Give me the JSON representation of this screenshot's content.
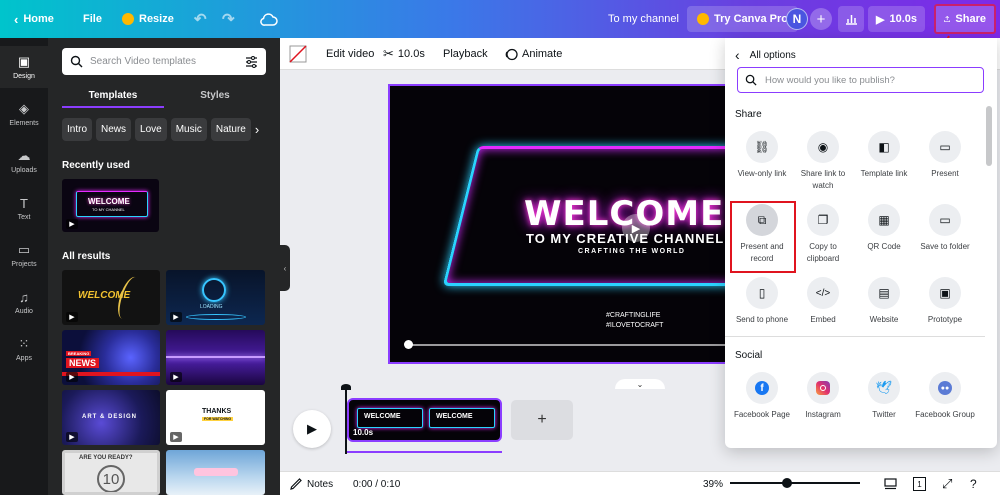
{
  "topbar": {
    "home": "Home",
    "file": "File",
    "resize": "Resize",
    "channel": "To my channel",
    "try_pro": "Try Canva Pro",
    "avatar_initial": "N",
    "play_duration": "10.0s",
    "share": "Share"
  },
  "rail": [
    {
      "label": "Design",
      "icon": "layout-icon"
    },
    {
      "label": "Elements",
      "icon": "shapes-icon"
    },
    {
      "label": "Uploads",
      "icon": "cloud-upload-icon"
    },
    {
      "label": "Text",
      "icon": "text-icon"
    },
    {
      "label": "Projects",
      "icon": "folder-icon"
    },
    {
      "label": "Audio",
      "icon": "music-icon"
    },
    {
      "label": "Apps",
      "icon": "apps-icon"
    }
  ],
  "panel": {
    "search_placeholder": "Search Video templates",
    "tabs": [
      "Templates",
      "Styles"
    ],
    "chips": [
      "Intro",
      "News",
      "Love",
      "Music",
      "Nature"
    ],
    "recently_used": "Recently used",
    "all_results": "All results",
    "thumb_texts": {
      "recent_title": "WELCOME",
      "recent_sub": "TO MY CHANNEL",
      "r1_title": "WELCOME",
      "r2_title": "LOADING",
      "r3_badge": "BREAKING",
      "r3_title": "NEWS",
      "r5_title": "ART & DESIGN",
      "r6_title": "THANKS",
      "r6_sub": "FOR WATCHING",
      "r7_title": "ARE YOU READY?",
      "r7_num": "10"
    }
  },
  "edit_toolbar": {
    "edit_video": "Edit video",
    "duration": "10.0s",
    "playback": "Playback",
    "animate": "Animate"
  },
  "canvas": {
    "welcome": "WELCOME",
    "to_my": "TO MY CREATIVE CHANNEL",
    "crafting": "CRAFTING THE WORLD",
    "tag1": "#CRAFTINGLIFE",
    "tag2": "#ILOVETOCRAFT"
  },
  "timeline": {
    "clip_text": "WELCOME",
    "clip_duration": "10.0s",
    "add": "+"
  },
  "bottombar": {
    "notes": "Notes",
    "time": "0:00 / 0:10",
    "zoom": "39%",
    "page_count": "1"
  },
  "share_panel": {
    "back_title": "All options",
    "search_placeholder": "How would you like to publish?",
    "share_heading": "Share",
    "share_items": [
      {
        "label": "View-only link",
        "icon": "link-icon"
      },
      {
        "label": "Share link to watch",
        "icon": "eye-icon"
      },
      {
        "label": "Template link",
        "icon": "template-icon"
      },
      {
        "label": "Present",
        "icon": "present-icon"
      },
      {
        "label": "Present and record",
        "icon": "record-icon"
      },
      {
        "label": "Copy to clipboard",
        "icon": "copy-icon"
      },
      {
        "label": "QR Code",
        "icon": "qr-code-icon"
      },
      {
        "label": "Save to folder",
        "icon": "folder-icon"
      },
      {
        "label": "Send to phone",
        "icon": "phone-icon"
      },
      {
        "label": "Embed",
        "icon": "embed-icon"
      },
      {
        "label": "Website",
        "icon": "website-icon"
      },
      {
        "label": "Prototype",
        "icon": "prototype-icon"
      }
    ],
    "social_heading": "Social",
    "social_items": [
      {
        "label": "Facebook Page",
        "color": "#1877f2"
      },
      {
        "label": "Instagram",
        "color": "#e1306c"
      },
      {
        "label": "Twitter",
        "color": "#1d9bf0"
      },
      {
        "label": "Facebook Group",
        "color": "#5b7bd5"
      }
    ]
  },
  "colors": {
    "accent": "#8b3dff",
    "highlight": "#e0141f",
    "neon_pink": "#e52bff",
    "neon_cyan": "#2bd3ff"
  }
}
